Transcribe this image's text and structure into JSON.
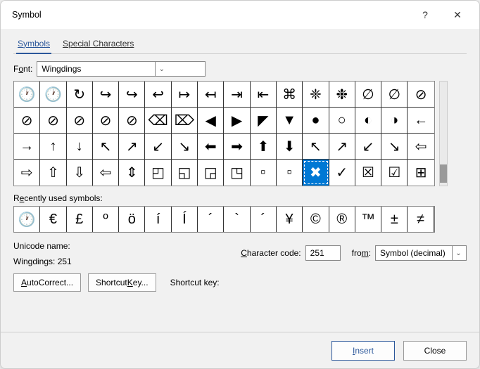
{
  "dialog": {
    "title": "Symbol",
    "help": "?",
    "close": "✕"
  },
  "tabs": {
    "symbols": "Symbols",
    "special": "Special Characters"
  },
  "font": {
    "label_pre": "F",
    "label_u": "o",
    "label_post": "nt:",
    "value": "Wingdings"
  },
  "grid": [
    [
      "🕐",
      "🕐",
      "↻",
      "↪",
      "↪",
      "↩",
      "↦",
      "↤",
      "⇥",
      "⇤",
      "⌘",
      "❈",
      "❉",
      "∅",
      "∅",
      "⊘"
    ],
    [
      "⊘",
      "⊘",
      "⊘",
      "⊘",
      "⊘",
      "⌫",
      "⌦",
      "◀",
      "▶",
      "◤",
      "▼",
      "●",
      "○",
      "◐",
      "◑",
      "←"
    ],
    [
      "→",
      "↑",
      "↓",
      "↖",
      "↗",
      "↙",
      "↘",
      "⬅",
      "➡",
      "⬆",
      "⬇",
      "↖",
      "↗",
      "↙",
      "↘",
      "⇦"
    ],
    [
      "⇨",
      "⇧",
      "⇩",
      "⇦",
      "⇕",
      "◰",
      "◱",
      "◲",
      "◳",
      "▫",
      "▫",
      "✖",
      "✓",
      "☒",
      "☑",
      "⊞"
    ]
  ],
  "grid_selected": {
    "row": 3,
    "col": 11
  },
  "recent": {
    "label_pre": "R",
    "label_u": "e",
    "label_post": "cently used symbols:",
    "items": [
      "🕐",
      "€",
      "£",
      "º",
      "ö",
      "í",
      "Í",
      "´",
      "`",
      "´",
      "¥",
      "©",
      "®",
      "™",
      "±",
      "≠"
    ]
  },
  "unicode": {
    "label": "Unicode name:",
    "value": "Wingdings: 251"
  },
  "charcode": {
    "label_pre": "",
    "label_u": "C",
    "label_post": "haracter code:",
    "value": "251"
  },
  "from": {
    "label_pre": "fro",
    "label_u": "m",
    "label_post": ":",
    "value": "Symbol (decimal)"
  },
  "buttons": {
    "autocorrect_pre": "",
    "autocorrect_u": "A",
    "autocorrect_post": "utoCorrect...",
    "shortcutkey_pre": "Shortcut ",
    "shortcutkey_u": "K",
    "shortcutkey_post": "ey...",
    "shortcut_label": "Shortcut key:"
  },
  "footer": {
    "insert_pre": "",
    "insert_u": "I",
    "insert_post": "nsert",
    "close": "Close"
  }
}
